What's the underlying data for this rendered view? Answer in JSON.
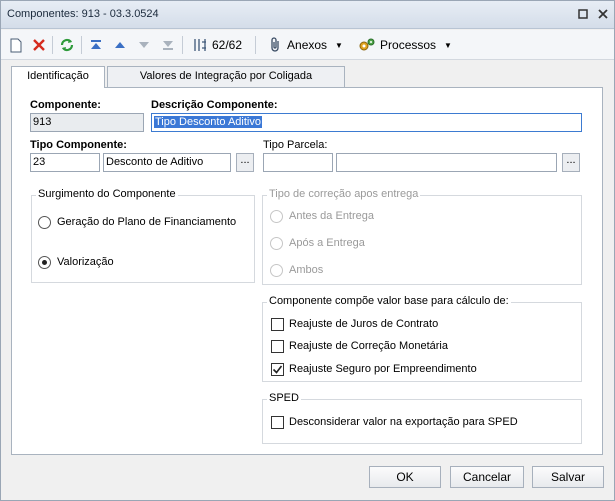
{
  "window": {
    "title": "Componentes: 913 - 03.3.0524"
  },
  "toolbar": {
    "record_counter": "62/62",
    "attachments_label": "Anexos",
    "processes_label": "Processos"
  },
  "tabs": [
    {
      "label": "Identificação"
    },
    {
      "label": "Valores de Integração por Coligada"
    }
  ],
  "form": {
    "component_label": "Componente:",
    "component_value": "913",
    "description_label": "Descrição Componente:",
    "description_value": "Tipo Desconto Aditivo",
    "type_label": "Tipo Componente:",
    "type_code": "23",
    "type_desc": "Desconto de Aditivo",
    "installment_type_label": "Tipo Parcela:",
    "installment_code": "",
    "installment_desc": "",
    "lookup_label": "..."
  },
  "origin_group": {
    "title": "Surgimento do Componente",
    "options": [
      {
        "label": "Geração do Plano de Financiamento",
        "selected": false
      },
      {
        "label": "Valorização",
        "selected": true
      }
    ]
  },
  "correction_group": {
    "title": "Tipo de correção apos entrega",
    "options": [
      {
        "label": "Antes da Entrega"
      },
      {
        "label": "Após a Entrega"
      },
      {
        "label": "Ambos"
      }
    ]
  },
  "base_group": {
    "title": "Componente compõe valor base para cálculo de:",
    "items": [
      {
        "label": "Reajuste de Juros de Contrato",
        "checked": false
      },
      {
        "label": "Reajuste de Correção Monetária",
        "checked": false
      },
      {
        "label": "Reajuste Seguro por Empreendimento",
        "checked": true
      }
    ]
  },
  "sped_group": {
    "title": "SPED",
    "item": {
      "label": "Desconsiderar valor na exportação para SPED",
      "checked": false
    }
  },
  "footer": {
    "ok_label": "OK",
    "cancel_label": "Cancelar",
    "save_label": "Salvar"
  }
}
